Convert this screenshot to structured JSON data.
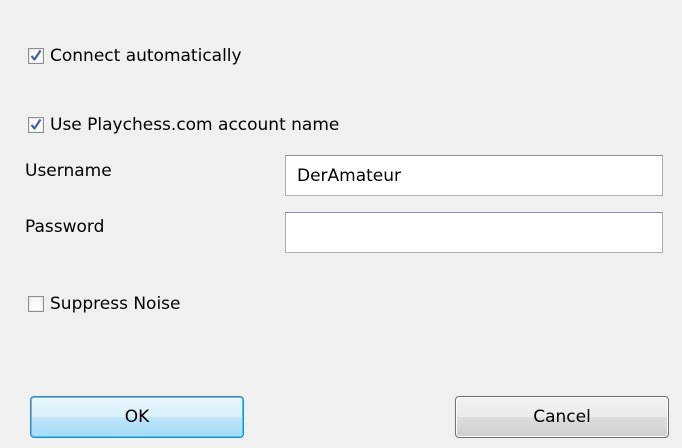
{
  "options": {
    "connect_automatically": {
      "label": "Connect automatically",
      "checked": true
    },
    "use_account_name": {
      "label": "Use Playchess.com account name",
      "checked": true
    },
    "suppress_noise": {
      "label": "Suppress Noise",
      "checked": false
    }
  },
  "fields": {
    "username": {
      "label": "Username",
      "value": "DerAmateur"
    },
    "password": {
      "label": "Password",
      "value": ""
    }
  },
  "buttons": {
    "ok_label": "OK",
    "cancel_label": "Cancel"
  },
  "colors": {
    "dialog_background": "#f0f0f0",
    "checkmark": "#4a5f97",
    "default_button_border": "#3c7fb1"
  }
}
